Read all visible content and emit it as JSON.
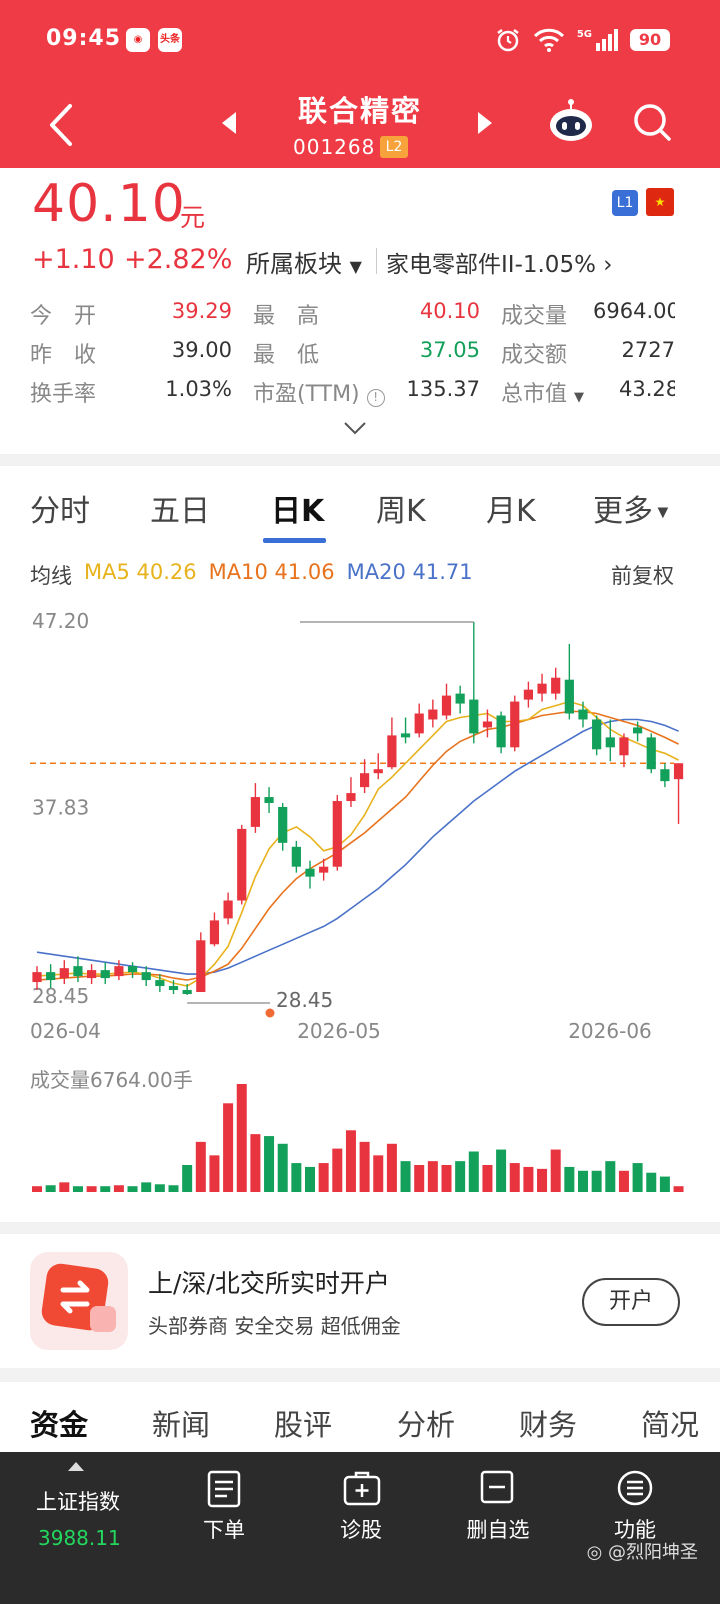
{
  "status_bar": {
    "time": "09:45",
    "app_icon_2": "头条",
    "network": "5G",
    "battery": "90"
  },
  "header": {
    "stock_name": "联合精密",
    "stock_code": "001268",
    "level_badge": "L2"
  },
  "quote": {
    "price": "40.10",
    "price_unit": "元",
    "level_badge": "L1",
    "change_abs": "+1.10",
    "change_pct": "+2.82%",
    "sector_label": "所属板块",
    "sector_value": "家电零部件II-1.05%",
    "stats": [
      {
        "label": "今　开",
        "value": "39.29"
      },
      {
        "label": "最　高",
        "value": "40.10"
      },
      {
        "label": "成交量",
        "value": "6964.00"
      },
      {
        "label": "昨　收",
        "value": "39.00"
      },
      {
        "label": "最　低",
        "value": "37.05"
      },
      {
        "label": "成交额",
        "value": "2727"
      },
      {
        "label": "换手率",
        "value": "1.03%"
      },
      {
        "label": "市盈(TTM)",
        "value": "135.37"
      },
      {
        "label": "总市值",
        "value": "43.28"
      }
    ]
  },
  "chart_tabs": [
    "分时",
    "五日",
    "日K",
    "周K",
    "月K",
    "更多"
  ],
  "ma": {
    "label": "均线",
    "ma5": "MA5 40.26",
    "ma10": "MA10 41.06",
    "ma20": "MA20 41.71",
    "adjust": "前复权",
    "colors": {
      "ma5": "#e8b21c",
      "ma10": "#e8731c",
      "ma20": "#4a72c8",
      "up": "#e8343e",
      "down": "#13a05a"
    }
  },
  "chart_data": {
    "type": "candlestick",
    "y_ticks": [
      "47.20",
      "37.83",
      "28.45"
    ],
    "ylim": [
      28.45,
      47.2
    ],
    "x_ticks": [
      "026-04",
      "2026-05",
      "2026-06"
    ],
    "high_marker": "47.20",
    "low_marker": "28.45",
    "last_price_line": 40.1,
    "candles": [
      {
        "o": 29.1,
        "c": 29.6,
        "h": 29.9,
        "l": 28.7
      },
      {
        "o": 29.6,
        "c": 29.2,
        "h": 30.0,
        "l": 28.8
      },
      {
        "o": 29.3,
        "c": 29.8,
        "h": 30.2,
        "l": 29.0
      },
      {
        "o": 29.9,
        "c": 29.4,
        "h": 30.4,
        "l": 29.1
      },
      {
        "o": 29.3,
        "c": 29.7,
        "h": 30.0,
        "l": 29.0
      },
      {
        "o": 29.7,
        "c": 29.3,
        "h": 30.1,
        "l": 29.0
      },
      {
        "o": 29.4,
        "c": 29.9,
        "h": 30.2,
        "l": 29.2
      },
      {
        "o": 29.9,
        "c": 29.6,
        "h": 30.1,
        "l": 29.3
      },
      {
        "o": 29.6,
        "c": 29.2,
        "h": 29.9,
        "l": 28.9
      },
      {
        "o": 29.2,
        "c": 28.9,
        "h": 29.5,
        "l": 28.6
      },
      {
        "o": 28.9,
        "c": 28.7,
        "h": 29.2,
        "l": 28.5
      },
      {
        "o": 28.7,
        "c": 28.5,
        "h": 29.0,
        "l": 28.45
      },
      {
        "o": 28.6,
        "c": 31.2,
        "h": 31.6,
        "l": 28.6
      },
      {
        "o": 31.0,
        "c": 32.2,
        "h": 32.6,
        "l": 30.9
      },
      {
        "o": 32.3,
        "c": 33.2,
        "h": 33.6,
        "l": 32.0
      },
      {
        "o": 33.2,
        "c": 36.8,
        "h": 37.0,
        "l": 33.0
      },
      {
        "o": 36.9,
        "c": 38.4,
        "h": 39.1,
        "l": 36.6
      },
      {
        "o": 38.4,
        "c": 38.1,
        "h": 38.9,
        "l": 37.6
      },
      {
        "o": 37.9,
        "c": 36.1,
        "h": 38.1,
        "l": 35.7
      },
      {
        "o": 35.9,
        "c": 34.9,
        "h": 36.2,
        "l": 34.6
      },
      {
        "o": 34.8,
        "c": 34.4,
        "h": 35.2,
        "l": 33.8
      },
      {
        "o": 34.6,
        "c": 34.9,
        "h": 35.3,
        "l": 34.2
      },
      {
        "o": 34.9,
        "c": 38.2,
        "h": 38.5,
        "l": 34.7
      },
      {
        "o": 38.2,
        "c": 38.6,
        "h": 39.4,
        "l": 37.9
      },
      {
        "o": 38.9,
        "c": 39.6,
        "h": 40.3,
        "l": 38.6
      },
      {
        "o": 39.6,
        "c": 39.8,
        "h": 40.6,
        "l": 39.3
      },
      {
        "o": 39.9,
        "c": 41.5,
        "h": 42.4,
        "l": 39.8
      },
      {
        "o": 41.6,
        "c": 41.4,
        "h": 42.4,
        "l": 41.1
      },
      {
        "o": 41.6,
        "c": 42.6,
        "h": 43.1,
        "l": 41.4
      },
      {
        "o": 42.3,
        "c": 42.8,
        "h": 43.3,
        "l": 41.9
      },
      {
        "o": 42.5,
        "c": 43.5,
        "h": 44.1,
        "l": 42.3
      },
      {
        "o": 43.6,
        "c": 43.1,
        "h": 44.0,
        "l": 42.6
      },
      {
        "o": 43.3,
        "c": 41.6,
        "h": 47.2,
        "l": 41.1
      },
      {
        "o": 41.9,
        "c": 42.2,
        "h": 42.8,
        "l": 41.4
      },
      {
        "o": 42.5,
        "c": 40.9,
        "h": 42.7,
        "l": 40.6
      },
      {
        "o": 40.9,
        "c": 43.2,
        "h": 43.5,
        "l": 40.7
      },
      {
        "o": 43.3,
        "c": 43.8,
        "h": 44.2,
        "l": 42.9
      },
      {
        "o": 43.6,
        "c": 44.1,
        "h": 44.6,
        "l": 43.2
      },
      {
        "o": 43.6,
        "c": 44.4,
        "h": 44.9,
        "l": 43.3
      },
      {
        "o": 44.3,
        "c": 42.6,
        "h": 46.1,
        "l": 42.3
      },
      {
        "o": 42.8,
        "c": 42.3,
        "h": 43.2,
        "l": 41.9
      },
      {
        "o": 42.3,
        "c": 40.8,
        "h": 42.5,
        "l": 40.5
      },
      {
        "o": 41.4,
        "c": 40.9,
        "h": 42.3,
        "l": 40.2
      },
      {
        "o": 40.5,
        "c": 41.4,
        "h": 41.6,
        "l": 39.9
      },
      {
        "o": 41.9,
        "c": 41.6,
        "h": 42.2,
        "l": 41.2
      },
      {
        "o": 41.4,
        "c": 39.8,
        "h": 41.6,
        "l": 39.6
      },
      {
        "o": 39.8,
        "c": 39.2,
        "h": 40.1,
        "l": 38.9
      },
      {
        "o": 39.3,
        "c": 40.1,
        "h": 40.1,
        "l": 37.05
      }
    ],
    "ma5": [
      29.4,
      29.45,
      29.5,
      29.55,
      29.5,
      29.5,
      29.55,
      29.6,
      29.5,
      29.3,
      29.05,
      28.9,
      29.3,
      30.0,
      30.9,
      32.6,
      34.4,
      35.8,
      36.6,
      36.9,
      36.4,
      35.7,
      35.9,
      36.5,
      37.5,
      38.8,
      39.4,
      40.1,
      40.8,
      41.5,
      42.2,
      42.4,
      42.5,
      42.6,
      42.2,
      42.2,
      42.3,
      42.8,
      43.0,
      43.2,
      43.0,
      42.4,
      41.8,
      41.4,
      41.1,
      40.8,
      40.6,
      40.26
    ],
    "ma10": [
      29.2,
      29.25,
      29.3,
      29.35,
      29.4,
      29.4,
      29.45,
      29.5,
      29.5,
      29.45,
      29.3,
      29.2,
      29.35,
      29.65,
      30.0,
      30.8,
      31.8,
      32.8,
      33.6,
      34.3,
      34.8,
      35.2,
      35.6,
      36.1,
      36.6,
      37.2,
      37.8,
      38.4,
      39.2,
      40.0,
      40.7,
      41.2,
      41.5,
      41.8,
      41.9,
      42.1,
      42.3,
      42.5,
      42.6,
      42.7,
      42.7,
      42.6,
      42.4,
      42.2,
      42.0,
      41.7,
      41.4,
      41.06
    ],
    "ma20": [
      30.6,
      30.5,
      30.4,
      30.3,
      30.2,
      30.1,
      30.0,
      29.9,
      29.8,
      29.7,
      29.6,
      29.5,
      29.5,
      29.6,
      29.8,
      30.1,
      30.4,
      30.7,
      31.0,
      31.3,
      31.6,
      31.9,
      32.3,
      32.8,
      33.3,
      33.8,
      34.4,
      35.0,
      35.7,
      36.4,
      37.0,
      37.6,
      38.2,
      38.7,
      39.2,
      39.7,
      40.1,
      40.5,
      40.9,
      41.3,
      41.7,
      42.0,
      42.2,
      42.3,
      42.3,
      42.2,
      42.0,
      41.71
    ],
    "volume_title": "成交量6764.00手",
    "volumes": [
      6,
      7,
      10,
      6,
      6,
      6,
      7,
      6,
      10,
      8,
      7,
      28,
      52,
      38,
      92,
      112,
      60,
      58,
      50,
      30,
      26,
      30,
      45,
      64,
      52,
      38,
      50,
      32,
      28,
      32,
      28,
      32,
      42,
      28,
      44,
      30,
      26,
      24,
      44,
      26,
      22,
      22,
      32,
      22,
      30,
      20,
      16,
      6
    ]
  },
  "promo": {
    "title": "上/深/北交所实时开户",
    "subtitle": "头部券商  安全交易  超低佣金",
    "button": "开户"
  },
  "info_tabs": [
    "资金",
    "新闻",
    "股评",
    "分析",
    "财务",
    "简况"
  ],
  "bottom_bar": {
    "index_name": "上证指数",
    "index_value": "3988.11",
    "buttons": [
      "下单",
      "诊股",
      "删自选",
      "功能"
    ],
    "watermark": "@烈阳坤圣"
  }
}
